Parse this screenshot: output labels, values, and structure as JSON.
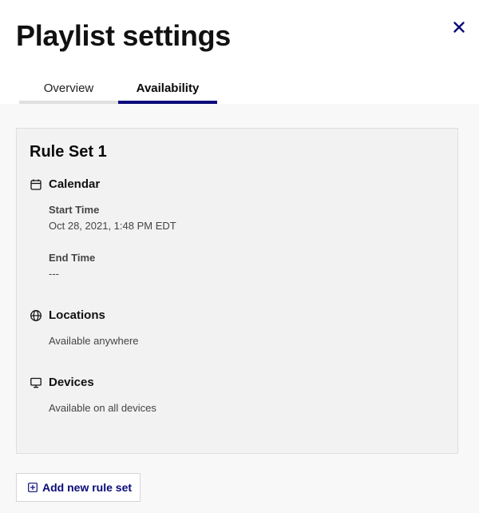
{
  "dialog": {
    "title": "Playlist settings",
    "close_icon": "close-icon"
  },
  "tabs": [
    {
      "label": "Overview",
      "active": false
    },
    {
      "label": "Availability",
      "active": true
    }
  ],
  "rule_set": {
    "title": "Rule Set 1",
    "calendar": {
      "icon": "calendar-icon",
      "label": "Calendar",
      "start_time_label": "Start Time",
      "start_time_value": "Oct 28, 2021, 1:48 PM EDT",
      "end_time_label": "End Time",
      "end_time_value": "---"
    },
    "locations": {
      "icon": "globe-icon",
      "label": "Locations",
      "value": "Available anywhere"
    },
    "devices": {
      "icon": "monitor-icon",
      "label": "Devices",
      "value": "Available on all devices"
    }
  },
  "add_button": {
    "icon": "plus-square-icon",
    "label": "Add new rule set"
  },
  "colors": {
    "accent": "#0a0a7a",
    "text": "#111111",
    "muted_text": "#444444",
    "card_bg": "#f2f2f2",
    "content_bg": "#f8f8f8"
  }
}
